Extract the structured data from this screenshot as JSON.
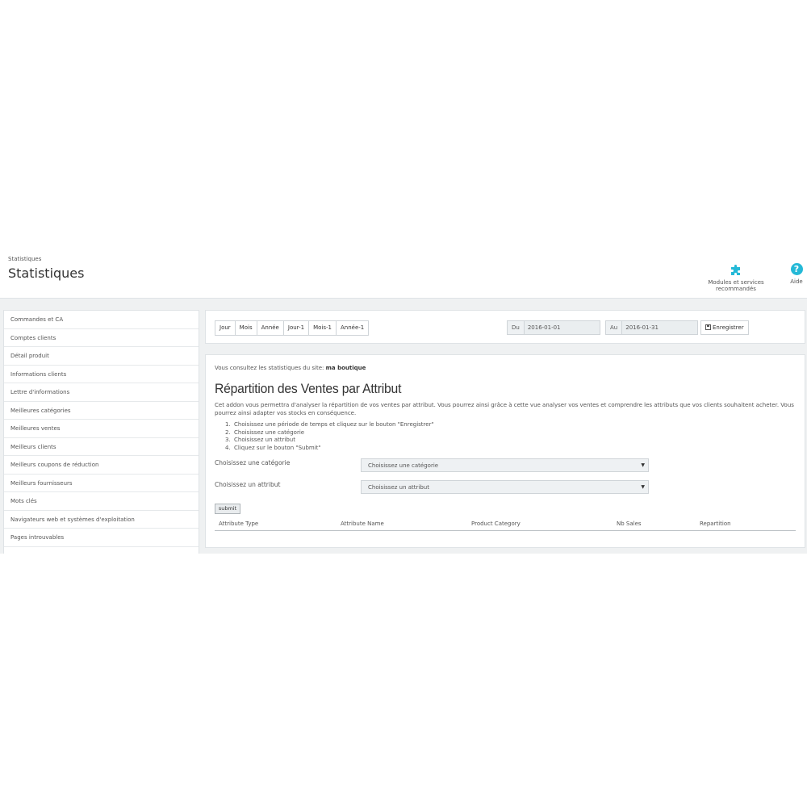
{
  "header": {
    "breadcrumb": "Statistiques",
    "title": "Statistiques",
    "toolbar": {
      "modules_label": "Modules et services recommandés",
      "help_label": "Aide",
      "help_glyph": "?"
    }
  },
  "sidebar": {
    "items": [
      {
        "label": "Commandes et CA"
      },
      {
        "label": "Comptes clients"
      },
      {
        "label": "Détail produit"
      },
      {
        "label": "Informations clients"
      },
      {
        "label": "Lettre d'informations"
      },
      {
        "label": "Meilleures catégories"
      },
      {
        "label": "Meilleures ventes"
      },
      {
        "label": "Meilleurs clients"
      },
      {
        "label": "Meilleurs coupons de réduction"
      },
      {
        "label": "Meilleurs fournisseurs"
      },
      {
        "label": "Mots clés"
      },
      {
        "label": "Navigateurs web et systèmes d'exploitation"
      },
      {
        "label": "Pages introuvables"
      },
      {
        "label": ""
      }
    ]
  },
  "date_filter": {
    "periods": [
      "Jour",
      "Mois",
      "Année",
      "Jour-1",
      "Mois-1",
      "Année-1"
    ],
    "from_label": "Du",
    "from_value": "2016-01-01",
    "to_label": "Au",
    "to_value": "2016-01-31",
    "save_label": "Enregistrer"
  },
  "main": {
    "site_prefix": "Vous consultez les statistiques du site:",
    "site_name": "ma boutique",
    "title": "Répartition des Ventes par Attribut",
    "description": "Cet addon vous permettra d'analyser la répartition de vos ventes par attribut. Vous pourrez ainsi grâce à cette vue analyser vos ventes et comprendre les attributs que vos clients souhaitent acheter. Vous pourrez ainsi adapter vos stocks en conséquence.",
    "steps": [
      {
        "num": "1.",
        "text": "Choisissez une période de temps et cliquez sur le bouton \"Enregistrer\""
      },
      {
        "num": "2.",
        "text": "Choisissez une catégorie"
      },
      {
        "num": "3.",
        "text": "Choisissez un attribut"
      },
      {
        "num": "4.",
        "text": "Cliquez sur le bouton \"Submit\""
      }
    ],
    "category_label": "Choisissez une catégorie",
    "category_value": "Choisissez une catégorie",
    "attribute_label": "Choisissez un attribut",
    "attribute_value": "Choisissez un attribut",
    "submit_label": "submit",
    "table_headers": [
      "Attribute Type",
      "Attribute Name",
      "Product Category",
      "Nb Sales",
      "Repartition"
    ]
  },
  "colors": {
    "accent": "#25b9d7",
    "background": "#eff1f2"
  },
  "icons": {
    "modules": "puzzle-icon",
    "help": "help-icon",
    "save": "floppy-icon",
    "select_caret": "caret-down-icon"
  }
}
